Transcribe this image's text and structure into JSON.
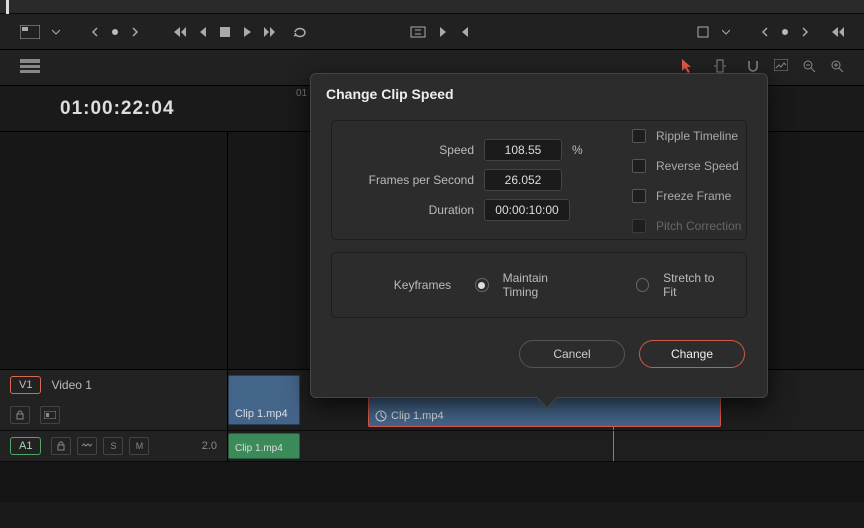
{
  "timecode": "01:00:22:04",
  "ruler": {
    "label0": "01"
  },
  "dialog": {
    "title": "Change Clip Speed",
    "speed_label": "Speed",
    "speed_value": "108.55",
    "speed_unit": "%",
    "fps_label": "Frames per Second",
    "fps_value": "26.052",
    "duration_label": "Duration",
    "duration_value": "00:00:10:00",
    "ripple_label": "Ripple Timeline",
    "reverse_label": "Reverse Speed",
    "freeze_label": "Freeze Frame",
    "pitch_label": "Pitch Correction",
    "keyframes_label": "Keyframes",
    "maintain_label": "Maintain Timing",
    "stretch_label": "Stretch to Fit",
    "cancel_label": "Cancel",
    "change_label": "Change",
    "keyframes_selected": "maintain"
  },
  "tracks": {
    "video": {
      "badge": "V1",
      "name": "Video 1",
      "clip1_name": "Clip 1.mp4",
      "clip2_name": "Clip 1.mp4"
    },
    "audio": {
      "badge": "A1",
      "num": "2.0",
      "s_label": "S",
      "m_label": "M",
      "clip_name": "Clip 1.mp4"
    }
  },
  "icons": {
    "view_mode": "view-mode-icon",
    "prev_dot": "prev-marker-icon",
    "skip_start": "skip-start-icon",
    "step_back": "step-back-icon",
    "stop": "stop-icon",
    "play": "play-icon",
    "skip_end": "skip-end-icon",
    "loop": "loop-icon",
    "insert": "insert-icon",
    "next_clip": "next-clip-icon",
    "prev_clip": "prev-clip-icon",
    "crop": "crop-icon",
    "timeline_view": "timeline-view-icon",
    "arrow": "arrow-tool-icon",
    "blade": "blade-tool-icon",
    "zoom_out": "zoom-out-icon",
    "zoom_in": "zoom-in-icon",
    "lock": "lock-icon",
    "auto_select": "auto-select-icon",
    "link": "link-icon",
    "speed_clip": "speed-icon"
  }
}
